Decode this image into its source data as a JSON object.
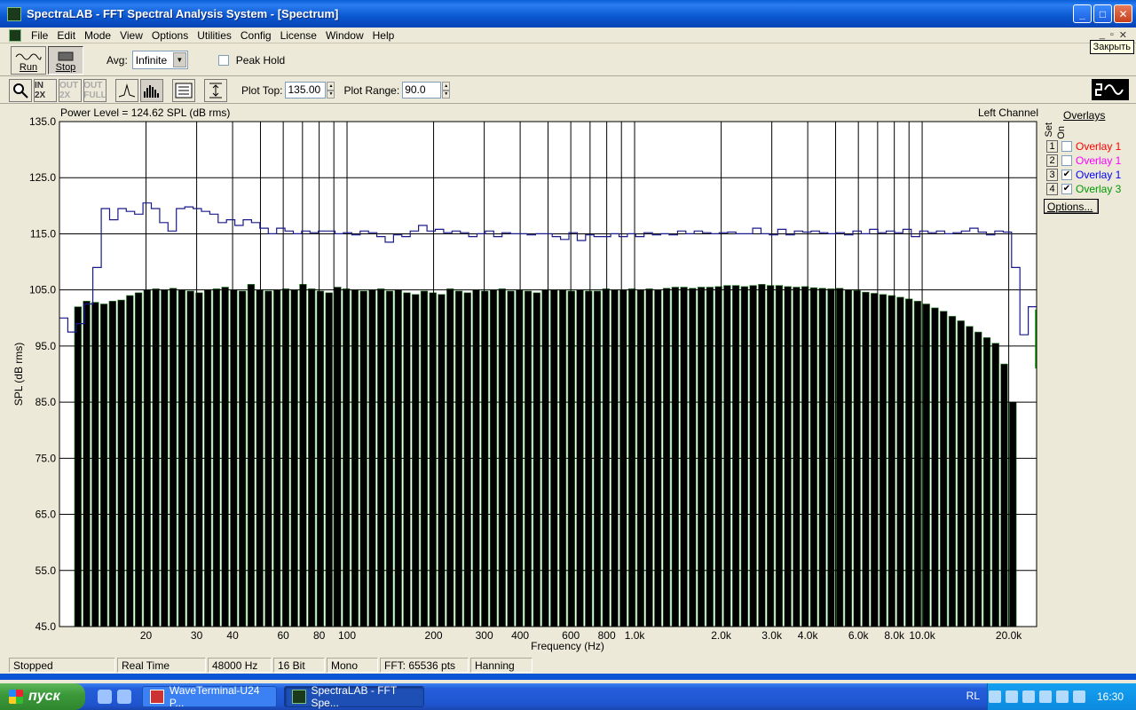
{
  "window": {
    "title": "SpectraLAB - FFT Spectral Analysis System - [Spectrum]",
    "tooltip": "Закрыть"
  },
  "menu": [
    "File",
    "Edit",
    "Mode",
    "View",
    "Options",
    "Utilities",
    "Config",
    "License",
    "Window",
    "Help"
  ],
  "toolbar": {
    "run_label": "Run",
    "stop_label": "Stop",
    "avg_label": "Avg:",
    "avg_value": "Infinite",
    "peak_hold_label": "Peak Hold",
    "peak_hold_checked": false,
    "zoom_buttons": [
      "IN 2X",
      "OUT 2X",
      "OUT FULL"
    ],
    "plot_top_label": "Plot Top:",
    "plot_top_value": "135.00",
    "plot_range_label": "Plot Range:",
    "plot_range_value": "90.0"
  },
  "plot_header": {
    "power_level": "Power Level = 124.62 SPL (dB rms)",
    "channel": "Left Channel"
  },
  "overlays": {
    "title": "Overlays",
    "col_set": "Set",
    "col_on": "On",
    "items": [
      {
        "num": "1",
        "label": "Overlay 1",
        "checked": false,
        "color": "#ff0000"
      },
      {
        "num": "2",
        "label": "Overlay 1",
        "checked": false,
        "color": "#ff00ff"
      },
      {
        "num": "3",
        "label": "Overlay 1",
        "checked": true,
        "color": "#0000ff"
      },
      {
        "num": "4",
        "label": "Overlay 3",
        "checked": true,
        "color": "#009900"
      }
    ],
    "options_label": "Options..."
  },
  "chart_data": {
    "type": "bar",
    "xlabel": "Frequency (Hz)",
    "ylabel": "SPL (dB rms)",
    "x_scale": "log",
    "xlim": [
      10,
      25000
    ],
    "ylim": [
      45,
      135
    ],
    "yticks": [
      "135.0",
      "125.0",
      "115.0",
      "105.0",
      "95.0",
      "85.0",
      "75.0",
      "65.0",
      "55.0",
      "45.0"
    ],
    "xticks": [
      {
        "v": 20,
        "label": "20"
      },
      {
        "v": 30,
        "label": "30"
      },
      {
        "v": 40,
        "label": "40"
      },
      {
        "v": 60,
        "label": "60"
      },
      {
        "v": 80,
        "label": "80"
      },
      {
        "v": 100,
        "label": "100"
      },
      {
        "v": 200,
        "label": "200"
      },
      {
        "v": 300,
        "label": "300"
      },
      {
        "v": 400,
        "label": "400"
      },
      {
        "v": 600,
        "label": "600"
      },
      {
        "v": 800,
        "label": "800"
      },
      {
        "v": 1000,
        "label": "1.0k"
      },
      {
        "v": 2000,
        "label": "2.0k"
      },
      {
        "v": 3000,
        "label": "3.0k"
      },
      {
        "v": 4000,
        "label": "4.0k"
      },
      {
        "v": 6000,
        "label": "6.0k"
      },
      {
        "v": 8000,
        "label": "8.0k"
      },
      {
        "v": 10000,
        "label": "10.0k"
      },
      {
        "v": 20000,
        "label": "20.0k"
      }
    ],
    "gridlines_x": [
      20,
      30,
      40,
      50,
      60,
      70,
      80,
      90,
      100,
      200,
      300,
      400,
      500,
      600,
      700,
      800,
      900,
      1000,
      2000,
      3000,
      4000,
      5000,
      6000,
      7000,
      8000,
      9000,
      10000,
      20000
    ],
    "grid": true,
    "bar_series": {
      "name": "Spectrum",
      "color": "#000000",
      "edge_color": "#2e8b2e",
      "f_start": 11.2,
      "bands_per_octave": 10,
      "values": [
        102,
        103,
        102.8,
        102.5,
        103,
        103.2,
        104,
        104.5,
        105,
        105.2,
        105,
        105.3,
        105,
        104.8,
        104.5,
        105,
        105.2,
        105.5,
        105,
        104.8,
        106,
        105,
        104.8,
        105,
        105.2,
        105,
        106,
        105.2,
        104.8,
        104.5,
        105.5,
        105.2,
        105,
        104.8,
        105,
        105.2,
        104.8,
        105,
        104.5,
        104.2,
        104.8,
        104.5,
        104.2,
        105.2,
        104.8,
        104.5,
        105,
        104.8,
        105,
        105.2,
        104.8,
        105,
        104.8,
        104.5,
        105,
        105,
        105,
        104.8,
        105,
        104.8,
        104.8,
        105.2,
        105,
        105,
        105.2,
        105,
        105.2,
        105,
        105.3,
        105.5,
        105.5,
        105.3,
        105.5,
        105.5,
        105.6,
        105.8,
        105.8,
        105.6,
        105.8,
        106,
        105.8,
        105.8,
        105.6,
        105.5,
        105.6,
        105.4,
        105.3,
        105.2,
        105.3,
        105,
        104.9,
        104.6,
        104.4,
        104.2,
        104,
        103.7,
        103.4,
        103,
        102.5,
        101.8,
        101.2,
        100.3,
        99.5,
        98.5,
        97.5,
        96.5,
        95.5,
        91.8,
        85
      ]
    },
    "line_series": {
      "name": "Overlay 1",
      "color": "#1a1a8a",
      "values": [
        100,
        97.5,
        99,
        102.5,
        109,
        119.5,
        117.5,
        119.5,
        119,
        118.5,
        120.5,
        119.5,
        117,
        115.5,
        119.5,
        119.8,
        119.5,
        119,
        118.5,
        117,
        117.5,
        116.5,
        117.5,
        117,
        116,
        115,
        116,
        115.5,
        115,
        115.5,
        115.2,
        115.5,
        115.5,
        115,
        115.2,
        114.8,
        115.5,
        115.2,
        114.5,
        113.5,
        114.8,
        114.5,
        115.5,
        116.5,
        115.5,
        115.8,
        115.2,
        115.5,
        115.2,
        114.5,
        115,
        115.5,
        114.5,
        115.2,
        115,
        115,
        114.8,
        115,
        115,
        114.5,
        114,
        115.2,
        113.8,
        114.8,
        114.5,
        114.5,
        115,
        114.5,
        115,
        114.5,
        115.2,
        114.8,
        115,
        114.8,
        115.5,
        115,
        115.5,
        115.2,
        115,
        115.2,
        115.3,
        115,
        115,
        116,
        115,
        114.8,
        115.8,
        114.8,
        115.5,
        115.3,
        115.5,
        115.2,
        115,
        115.2,
        114.8,
        115.5,
        115,
        115.8,
        115.2,
        115.5,
        115.2,
        115.8,
        114.5,
        115.5,
        115.2,
        115.5,
        115,
        115.2,
        115.5,
        116,
        115.3,
        114.8,
        115.5,
        115.3,
        109,
        97,
        102
      ]
    },
    "tail_line_color": "#00a000"
  },
  "status": [
    "Stopped",
    "Real Time",
    "48000 Hz",
    "16 Bit",
    "Mono",
    "FFT: 65536 pts",
    "Hanning"
  ],
  "taskbar": {
    "start_label": "пуск",
    "tasks": [
      "WaveTerminal-U24 P...",
      "SpectraLAB - FFT Spe..."
    ],
    "lang": "RL",
    "clock": "16:30"
  }
}
